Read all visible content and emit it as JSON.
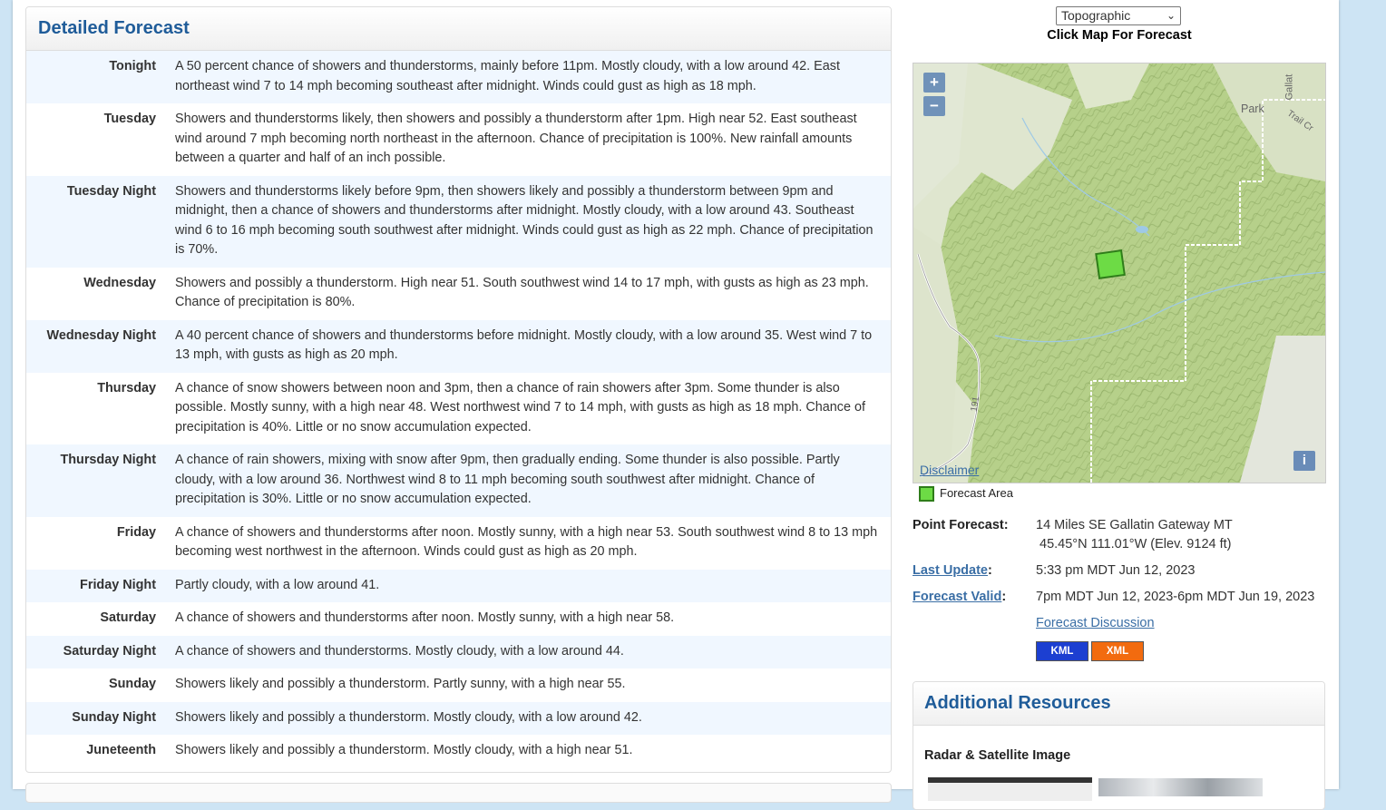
{
  "forecast": {
    "title": "Detailed Forecast",
    "periods": [
      {
        "label": "Tonight",
        "text": "A 50 percent chance of showers and thunderstorms, mainly before 11pm. Mostly cloudy, with a low around 42. East northeast wind 7 to 14 mph becoming southeast after midnight. Winds could gust as high as 18 mph."
      },
      {
        "label": "Tuesday",
        "text": "Showers and thunderstorms likely, then showers and possibly a thunderstorm after 1pm. High near 52. East southeast wind around 7 mph becoming north northeast in the afternoon. Chance of precipitation is 100%. New rainfall amounts between a quarter and half of an inch possible."
      },
      {
        "label": "Tuesday Night",
        "text": "Showers and thunderstorms likely before 9pm, then showers likely and possibly a thunderstorm between 9pm and midnight, then a chance of showers and thunderstorms after midnight. Mostly cloudy, with a low around 43. Southeast wind 6 to 16 mph becoming south southwest after midnight. Winds could gust as high as 22 mph. Chance of precipitation is 70%."
      },
      {
        "label": "Wednesday",
        "text": "Showers and possibly a thunderstorm. High near 51. South southwest wind 14 to 17 mph, with gusts as high as 23 mph. Chance of precipitation is 80%."
      },
      {
        "label": "Wednesday Night",
        "text": "A 40 percent chance of showers and thunderstorms before midnight. Mostly cloudy, with a low around 35. West wind 7 to 13 mph, with gusts as high as 20 mph."
      },
      {
        "label": "Thursday",
        "text": "A chance of snow showers between noon and 3pm, then a chance of rain showers after 3pm. Some thunder is also possible. Mostly sunny, with a high near 48. West northwest wind 7 to 14 mph, with gusts as high as 18 mph. Chance of precipitation is 40%. Little or no snow accumulation expected."
      },
      {
        "label": "Thursday Night",
        "text": "A chance of rain showers, mixing with snow after 9pm, then gradually ending. Some thunder is also possible. Partly cloudy, with a low around 36. Northwest wind 8 to 11 mph becoming south southwest after midnight. Chance of precipitation is 30%. Little or no snow accumulation expected."
      },
      {
        "label": "Friday",
        "text": "A chance of showers and thunderstorms after noon. Mostly sunny, with a high near 53. South southwest wind 8 to 13 mph becoming west northwest in the afternoon. Winds could gust as high as 20 mph."
      },
      {
        "label": "Friday Night",
        "text": "Partly cloudy, with a low around 41."
      },
      {
        "label": "Saturday",
        "text": "A chance of showers and thunderstorms after noon. Mostly sunny, with a high near 58."
      },
      {
        "label": "Saturday Night",
        "text": "A chance of showers and thunderstorms. Mostly cloudy, with a low around 44."
      },
      {
        "label": "Sunday",
        "text": "Showers likely and possibly a thunderstorm. Partly sunny, with a high near 55."
      },
      {
        "label": "Sunday Night",
        "text": "Showers likely and possibly a thunderstorm. Mostly cloudy, with a low around 42."
      },
      {
        "label": "Juneteenth",
        "text": "Showers likely and possibly a thunderstorm. Mostly cloudy, with a high near 51."
      }
    ]
  },
  "map": {
    "select_value": "Topographic",
    "click_label": "Click Map For Forecast",
    "zoom_in": "+",
    "zoom_out": "−",
    "info": "i",
    "disclaimer": "Disclaimer",
    "labels": {
      "park": "Park",
      "gallatin": "Gallat",
      "trail": "Trail Cr",
      "route": "191"
    },
    "legend": "Forecast Area",
    "colors": {
      "forest": "#b6d08a",
      "open": "#dfe6cf",
      "forecast_area": "#6ddb45"
    }
  },
  "point_info": {
    "point_forecast_key": "Point Forecast:",
    "location": "14 Miles SE Gallatin Gateway MT",
    "coords": "45.45°N 111.01°W (Elev. 9124 ft)",
    "last_update_key": "Last Update",
    "last_update": "5:33 pm MDT Jun 12, 2023",
    "forecast_valid_key": "Forecast Valid",
    "forecast_valid": "7pm MDT Jun 12, 2023-6pm MDT Jun 19, 2023",
    "colon": ":",
    "discussion": "Forecast Discussion",
    "kml": "KML",
    "xml": "XML"
  },
  "resources": {
    "title": "Additional Resources",
    "radar_label": "Radar & Satellite Image"
  }
}
